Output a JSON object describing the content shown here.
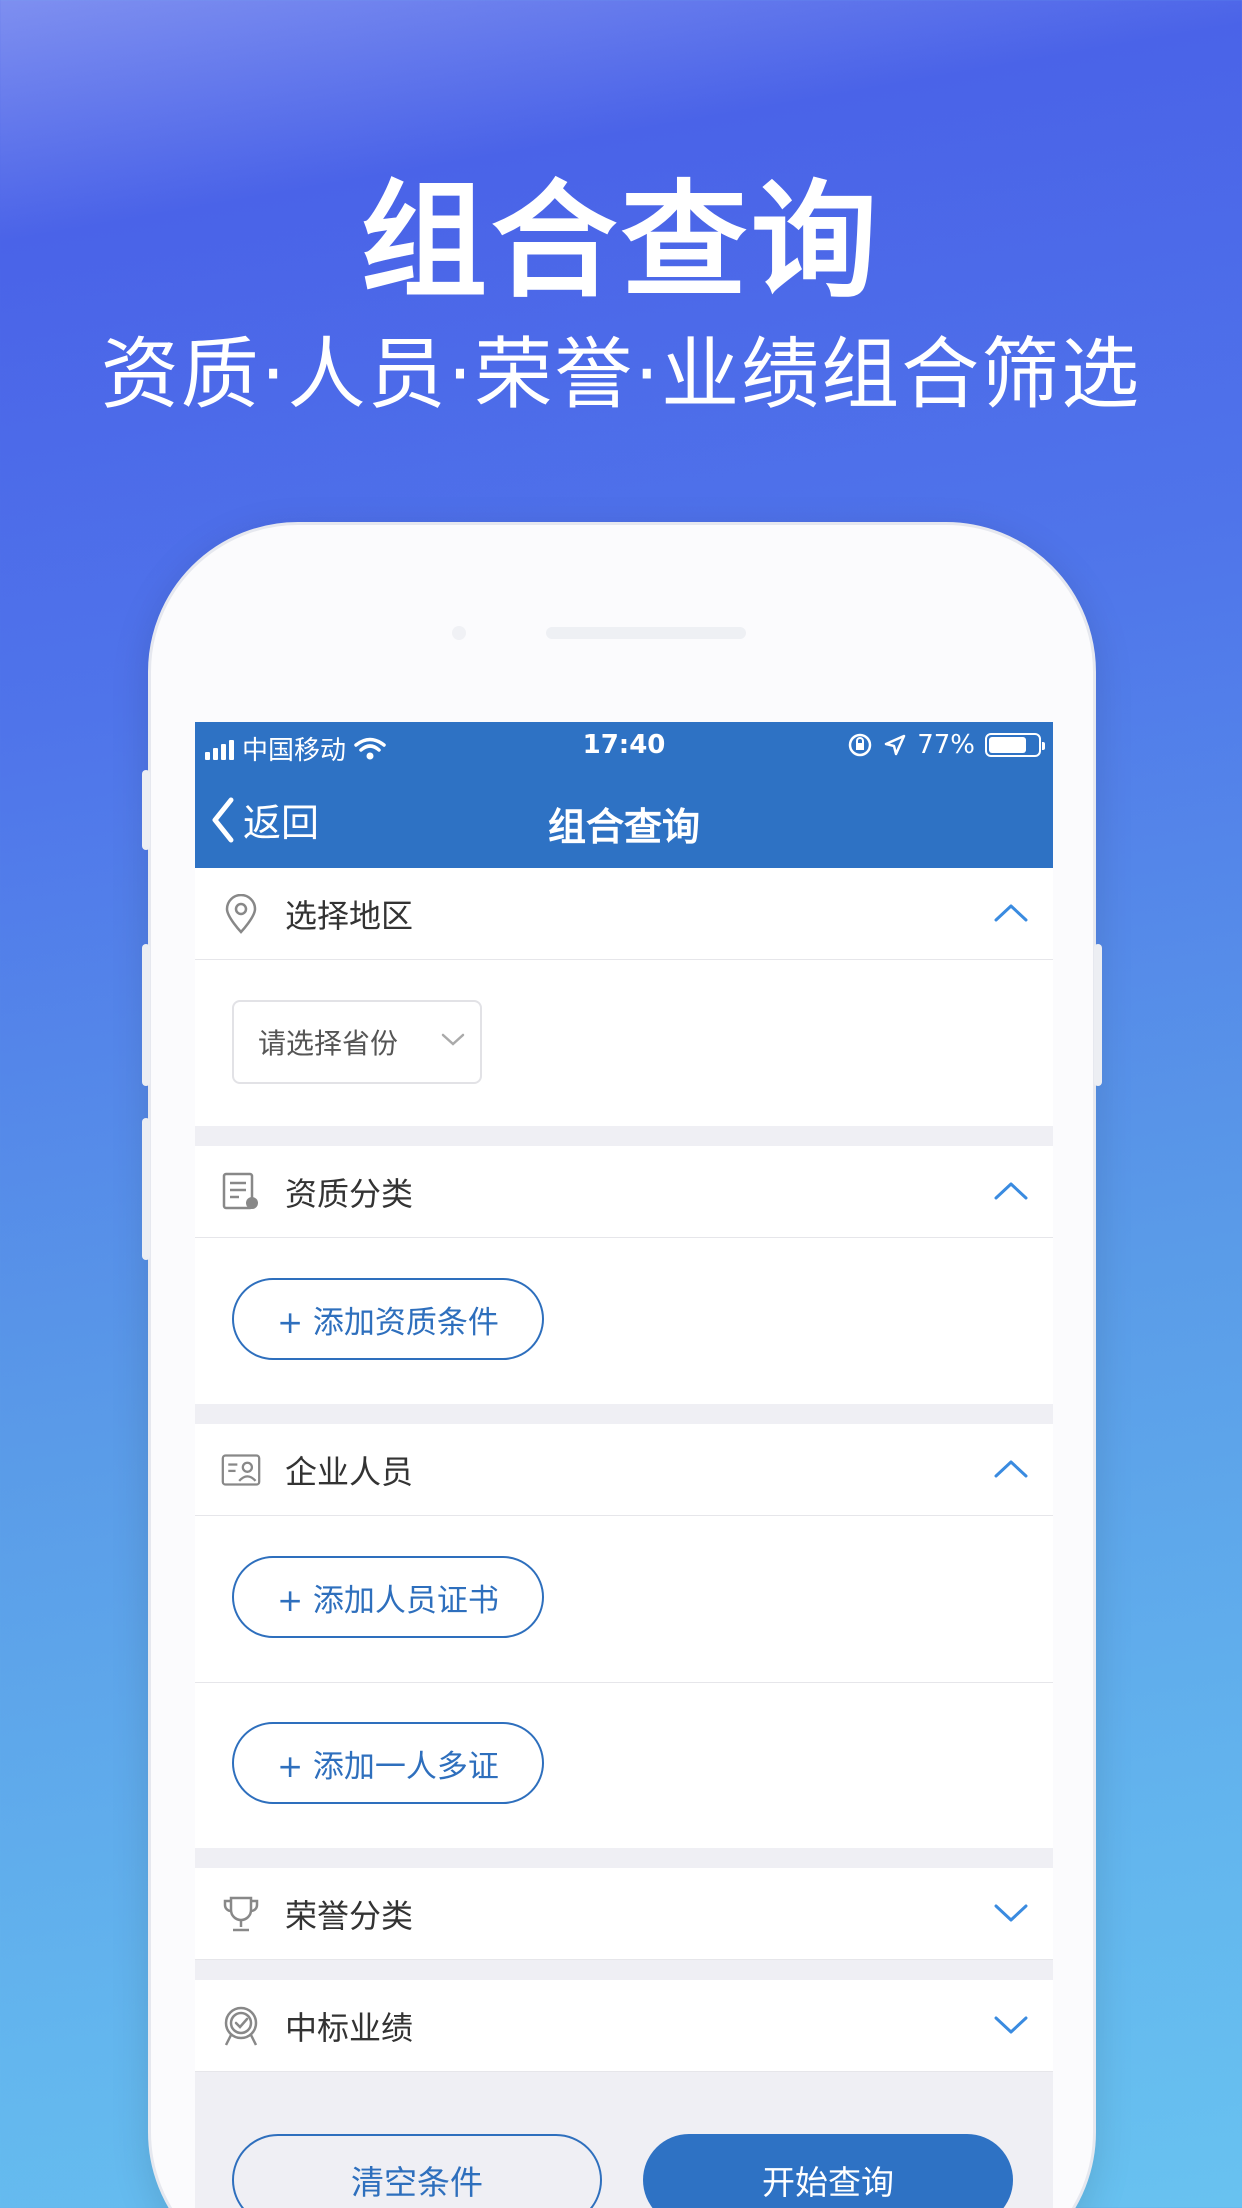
{
  "hero": {
    "title": "组合查询",
    "subtitle": "资质·人员·荣誉·业绩组合筛选"
  },
  "status_bar": {
    "carrier": "中国移动",
    "time": "17:40",
    "battery": "77%",
    "battery_level": 0.77
  },
  "nav": {
    "back_label": "返回",
    "title": "组合查询"
  },
  "sections": {
    "region": {
      "label": "选择地区",
      "icon": "location-pin-icon",
      "expanded": true,
      "province_placeholder": "请选择省份"
    },
    "qualification": {
      "label": "资质分类",
      "icon": "certificate-icon",
      "expanded": true,
      "add_label": "+ 添加资质条件"
    },
    "personnel": {
      "label": "企业人员",
      "icon": "id-card-icon",
      "expanded": true,
      "add_cert_label": "+ 添加人员证书",
      "add_multi_label": "+ 添加一人多证"
    },
    "honor": {
      "label": "荣誉分类",
      "icon": "trophy-icon",
      "expanded": false
    },
    "performance": {
      "label": "中标业绩",
      "icon": "award-badge-icon",
      "expanded": false
    }
  },
  "actions": {
    "clear_label": "清空条件",
    "query_label": "开始查询"
  },
  "colors": {
    "primary": "#2e72c4",
    "accent_outline": "#2e6fbd",
    "chevron": "#3a8be0"
  }
}
